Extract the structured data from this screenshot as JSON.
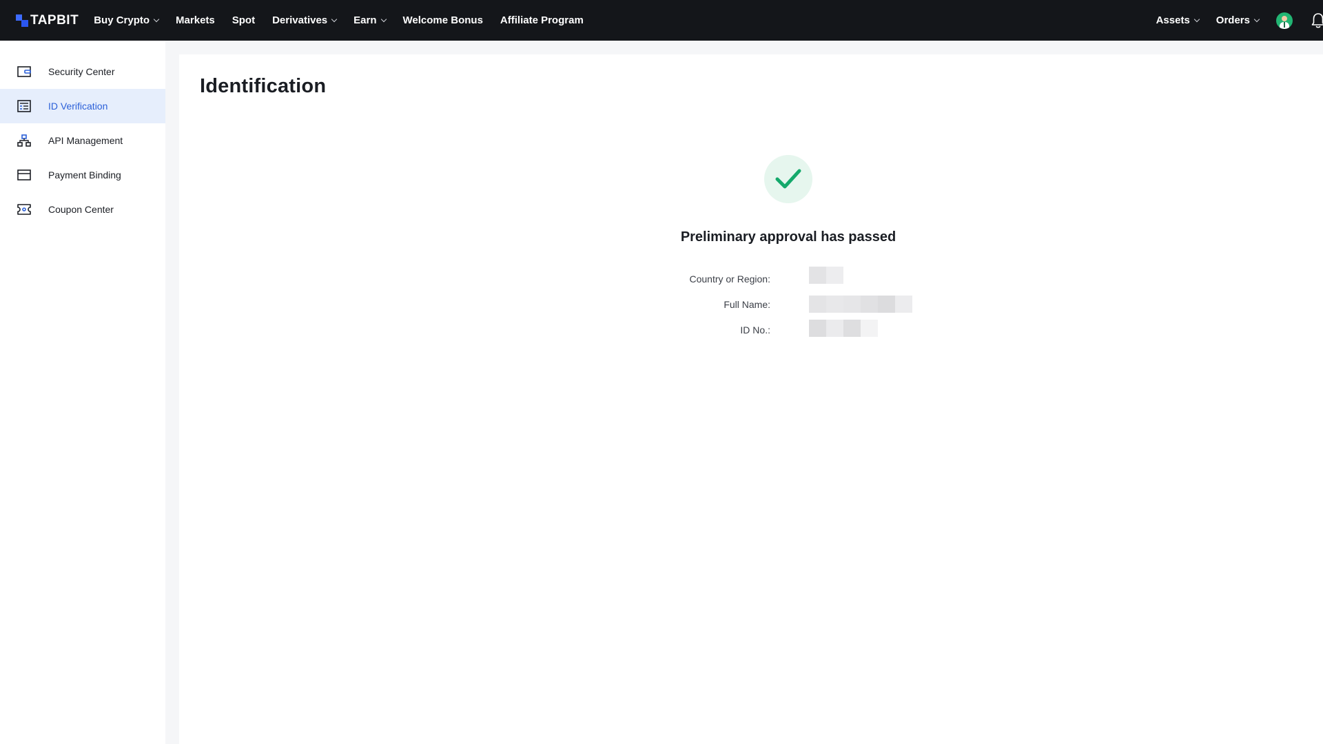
{
  "navbar": {
    "logo_text": "TAPBIT",
    "items": [
      {
        "label": "Buy Crypto",
        "dropdown": true
      },
      {
        "label": "Markets",
        "dropdown": false
      },
      {
        "label": "Spot",
        "dropdown": false
      },
      {
        "label": "Derivatives",
        "dropdown": true
      },
      {
        "label": "Earn",
        "dropdown": true
      },
      {
        "label": "Welcome Bonus",
        "dropdown": false
      },
      {
        "label": "Affiliate Program",
        "dropdown": false
      }
    ],
    "right_items": [
      {
        "label": "Assets",
        "dropdown": true
      },
      {
        "label": "Orders",
        "dropdown": true
      }
    ],
    "avatar_icon": "user-avatar-icon",
    "bell_icon": "bell-icon"
  },
  "sidebar": {
    "items": [
      {
        "label": "Security Center",
        "icon": "wallet-icon",
        "active": false
      },
      {
        "label": "ID Verification",
        "icon": "id-card-icon",
        "active": true
      },
      {
        "label": "API Management",
        "icon": "network-icon",
        "active": false
      },
      {
        "label": "Payment Binding",
        "icon": "card-icon",
        "active": false
      },
      {
        "label": "Coupon Center",
        "icon": "ticket-icon",
        "active": false
      }
    ]
  },
  "main": {
    "title": "Identification",
    "status_icon": "check-icon",
    "status_title": "Preliminary approval has passed",
    "fields": [
      {
        "label": "Country or Region:",
        "value": ""
      },
      {
        "label": "Full Name:",
        "value": ""
      },
      {
        "label": "ID No.:",
        "value": ""
      }
    ]
  },
  "colors": {
    "topbar_bg": "#14161a",
    "accent_blue": "#2a5fd8",
    "active_bg": "#e6eefc",
    "success_green": "#14a96b",
    "success_bg": "#e6f6ee",
    "page_bg": "#f5f6f8"
  }
}
